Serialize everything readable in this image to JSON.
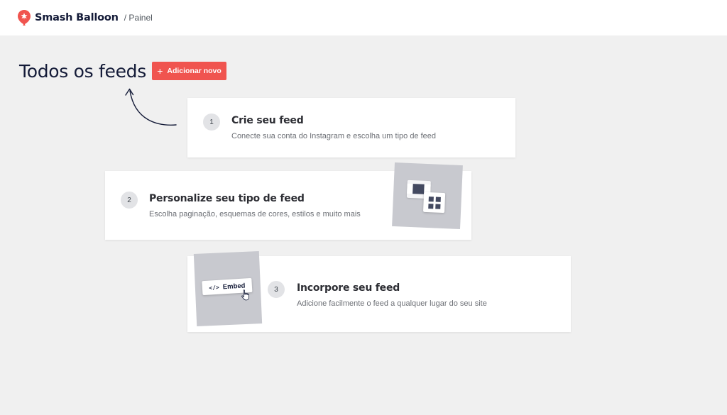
{
  "header": {
    "brand": "Smash Balloon",
    "breadcrumb": "/ Painel"
  },
  "page": {
    "title": "Todos os feeds",
    "add_button": "Adicionar novo"
  },
  "steps": [
    {
      "number": "1",
      "title": "Crie seu feed",
      "description": "Conecte sua conta do Instagram e escolha um tipo de feed"
    },
    {
      "number": "2",
      "title": "Personalize seu tipo de feed",
      "description": "Escolha paginação, esquemas de cores, estilos e muito mais"
    },
    {
      "number": "3",
      "title": "Incorpore seu feed",
      "description": "Adicione facilmente o feed a qualquer lugar do seu site"
    }
  ],
  "illustration": {
    "embed_label": "Embed",
    "embed_code_glyph": "</>"
  },
  "icons": {
    "logo": "smash-balloon-logo",
    "plus": "plus-icon",
    "arrow": "curved-arrow-icon",
    "cursor": "hand-pointer-icon"
  },
  "colors": {
    "accent": "#f0544f",
    "background": "#f0f0f0",
    "card": "#ffffff",
    "brand_text": "#141b38",
    "illustration_bg": "#c8c9cf",
    "illustration_dark": "#434960"
  }
}
